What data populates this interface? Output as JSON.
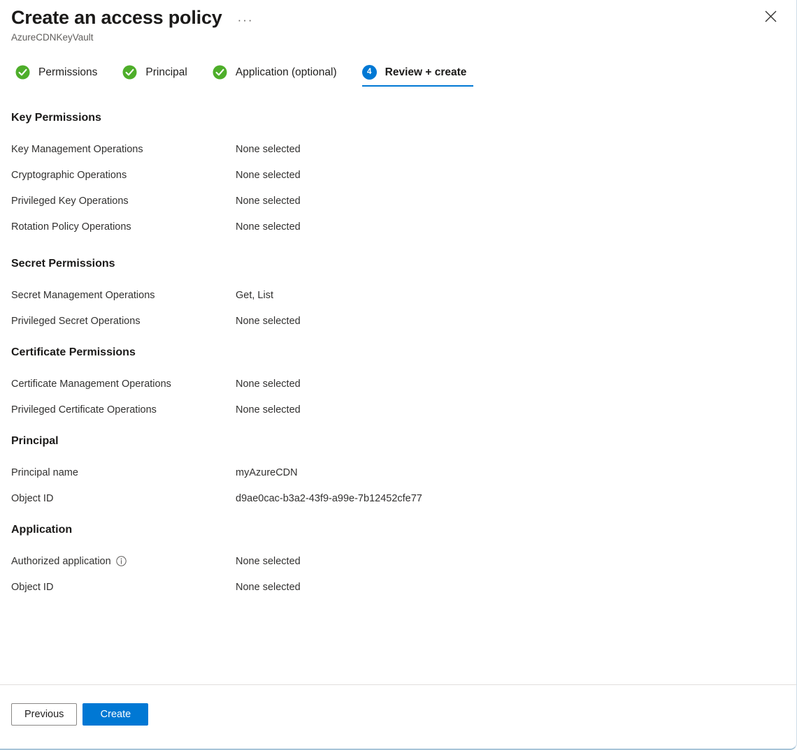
{
  "header": {
    "title": "Create an access policy",
    "subtitle": "AzureCDNKeyVault",
    "more_label": "···",
    "more_icon": "ellipsis-icon",
    "close_icon": "close-icon"
  },
  "wizard": {
    "tabs": [
      {
        "label": "Permissions",
        "state": "complete",
        "icon": "check-circle-icon",
        "badge": ""
      },
      {
        "label": "Principal",
        "state": "complete",
        "icon": "check-circle-icon",
        "badge": ""
      },
      {
        "label": "Application (optional)",
        "state": "complete",
        "icon": "check-circle-icon",
        "badge": ""
      },
      {
        "label": "Review + create",
        "state": "active",
        "icon": "step-number-badge",
        "badge": "4"
      }
    ]
  },
  "sections": [
    {
      "heading": "Key Permissions",
      "rows": [
        {
          "label": "Key Management Operations",
          "value": "None selected"
        },
        {
          "label": "Cryptographic Operations",
          "value": "None selected"
        },
        {
          "label": "Privileged Key Operations",
          "value": "None selected"
        },
        {
          "label": "Rotation Policy Operations",
          "value": "None selected"
        }
      ]
    },
    {
      "heading": "Secret Permissions",
      "rows": [
        {
          "label": "Secret Management Operations",
          "value": "Get, List"
        },
        {
          "label": "Privileged Secret Operations",
          "value": "None selected"
        }
      ]
    },
    {
      "heading": "Certificate Permissions",
      "rows": [
        {
          "label": "Certificate Management Operations",
          "value": "None selected"
        },
        {
          "label": "Privileged Certificate Operations",
          "value": "None selected"
        }
      ]
    },
    {
      "heading": "Principal",
      "rows": [
        {
          "label": "Principal name",
          "value": "myAzureCDN"
        },
        {
          "label": "Object ID",
          "value": "d9ae0cac-b3a2-43f9-a99e-7b12452cfe77"
        }
      ]
    },
    {
      "heading": "Application",
      "rows": [
        {
          "label": "Authorized application",
          "value": "None selected",
          "info": true
        },
        {
          "label": "Object ID",
          "value": "None selected"
        }
      ]
    }
  ],
  "footer": {
    "previous_label": "Previous",
    "create_label": "Create"
  },
  "colors": {
    "accent": "#0078d4",
    "success": "#4eae2a",
    "text": "#323130",
    "text_secondary": "#605e5c",
    "divider": "#e1dfdd",
    "blade_border": "#a6c4d8"
  }
}
